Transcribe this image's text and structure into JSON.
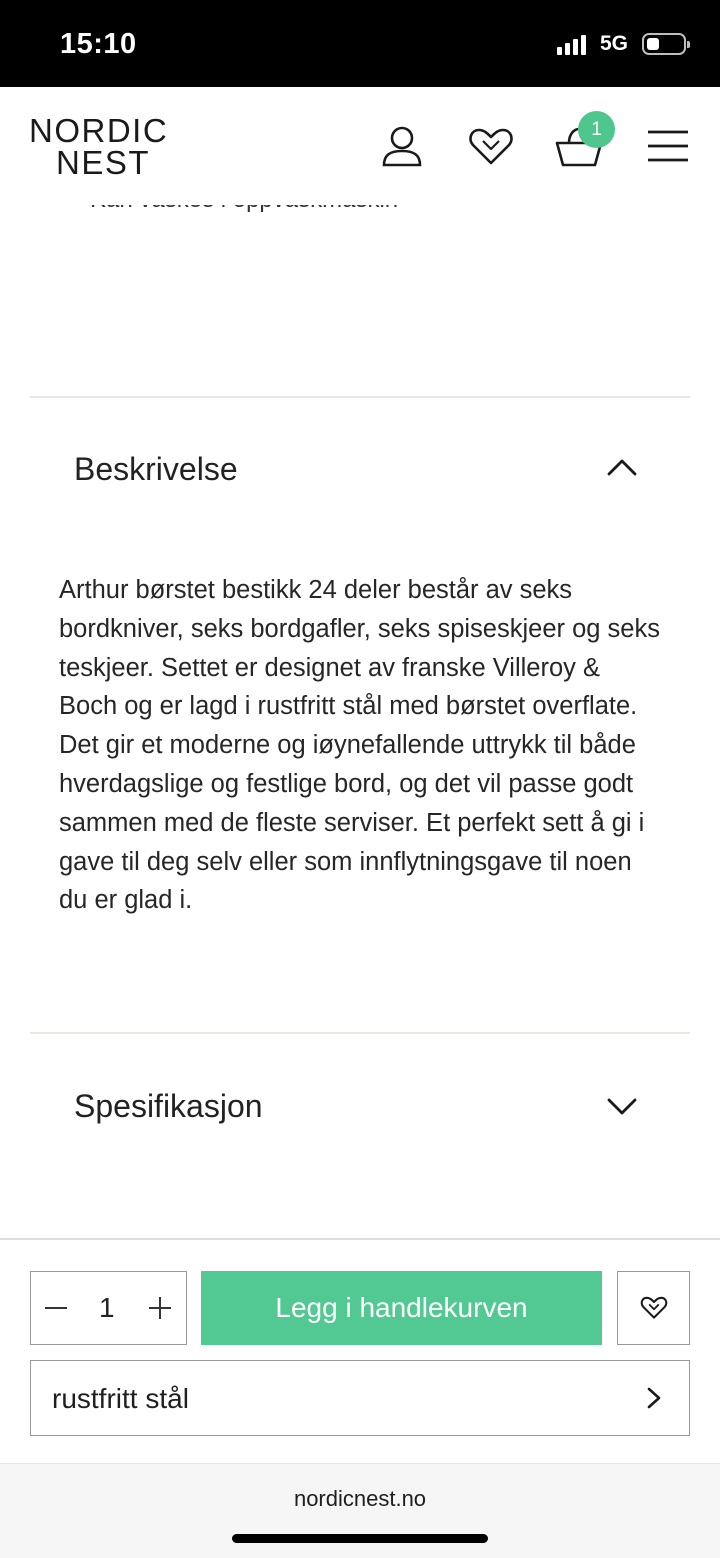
{
  "status_bar": {
    "time": "15:10",
    "network": "5G",
    "icons": [
      "signal-icon",
      "battery-icon"
    ]
  },
  "header": {
    "logo_line1": "NORDIC",
    "logo_line2": "NEST",
    "cart_count": "1",
    "icons": [
      "user-icon",
      "heart-icon",
      "cart-icon",
      "menu-icon"
    ]
  },
  "faded_text": "Kan vaskes i oppvaskmaskin",
  "accordions": [
    {
      "title": "Beskrivelse",
      "expanded": true,
      "icon": "chevron-up-icon",
      "body": "Arthur børstet bestikk 24 deler består av seks bordkniver, seks bordgafler, seks spiseskjeer og seks teskjeer. Settet er designet av franske Villeroy & Boch og er lagd i rustfritt stål med børstet overflate. Det gir et moderne og iøynefallende uttrykk til både hverdagslige og festlige bord, og det vil passe godt sammen med de fleste serviser. Et perfekt sett å gi i gave til deg selv eller som innflytningsgave til noen du er glad i."
    },
    {
      "title": "Spesifikasjon",
      "expanded": false,
      "icon": "chevron-down-icon"
    }
  ],
  "purchase": {
    "quantity": "1",
    "add_to_cart_label": "Legg i handlekurven",
    "variant_label": "rustfritt stål"
  },
  "browser": {
    "url": "nordicnest.no"
  },
  "colors": {
    "accent": "#52c893",
    "badge": "#4fc68d"
  }
}
